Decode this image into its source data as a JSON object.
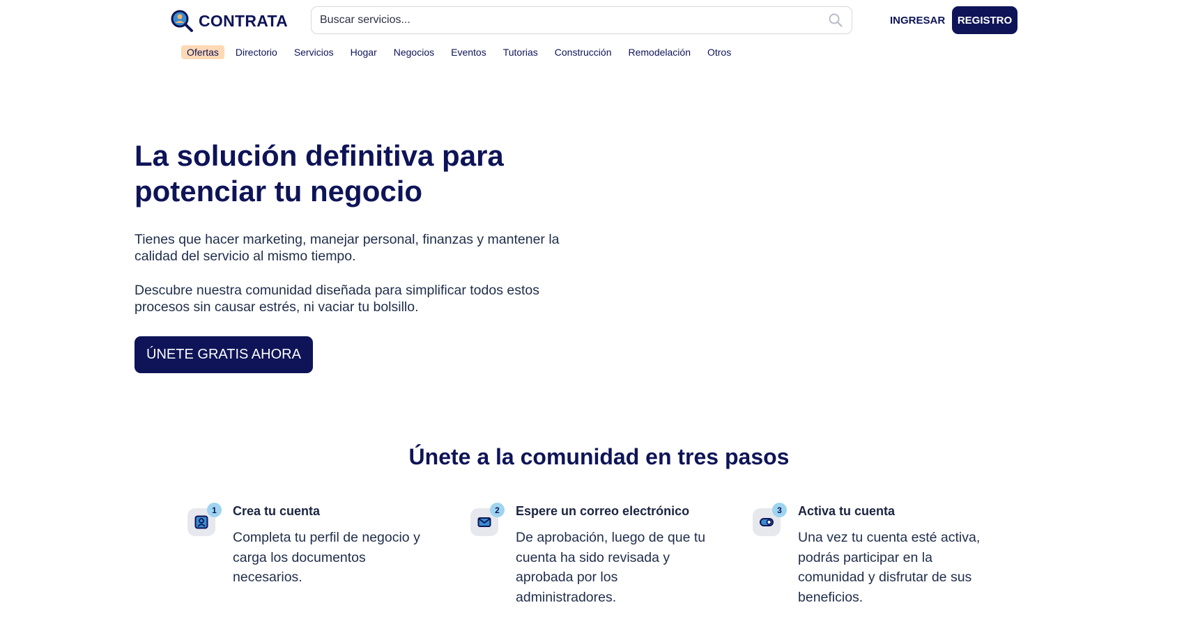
{
  "brand": {
    "name": "CONTRATA",
    "primary_color": "#0e1457",
    "accent_color": "#fdd9b5",
    "badge_color": "#9ed4ef"
  },
  "search": {
    "placeholder": "Buscar servicios..."
  },
  "auth": {
    "login_label": "INGRESAR",
    "register_label": "REGISTRO"
  },
  "nav": {
    "items": [
      {
        "label": "Ofertas",
        "active": true
      },
      {
        "label": "Directorio"
      },
      {
        "label": "Servicios"
      },
      {
        "label": "Hogar"
      },
      {
        "label": "Negocios"
      },
      {
        "label": "Eventos"
      },
      {
        "label": "Tutorias"
      },
      {
        "label": "Construcción"
      },
      {
        "label": "Remodelación"
      },
      {
        "label": "Otros"
      }
    ]
  },
  "hero": {
    "title": "La solución definitiva para potenciar tu negocio",
    "paragraph1": "Tienes que hacer marketing, manejar personal, finanzas y mantener la calidad del servicio al mismo tiempo.",
    "paragraph2": "Descubre nuestra comunidad diseñada para simplificar todos estos procesos sin causar estrés, ni vaciar tu bolsillo.",
    "cta_label": "ÚNETE GRATIS AHORA"
  },
  "steps": {
    "title": "Únete a la comunidad en tres pasos",
    "items": [
      {
        "number": "1",
        "icon": "profile-card-icon",
        "heading": "Crea tu cuenta",
        "text": "Completa tu perfil de negocio y carga los documentos necesarios."
      },
      {
        "number": "2",
        "icon": "envelope-icon",
        "heading": "Espere un correo electrónico",
        "text": "De aprobación, luego de que tu cuenta ha sido revisada y aprobada por los administradores."
      },
      {
        "number": "3",
        "icon": "toggle-icon",
        "heading": "Activa tu cuenta",
        "text": "Una vez tu cuenta esté activa, podrás participar en la comunidad y disfrutar de sus beneficios."
      }
    ]
  }
}
